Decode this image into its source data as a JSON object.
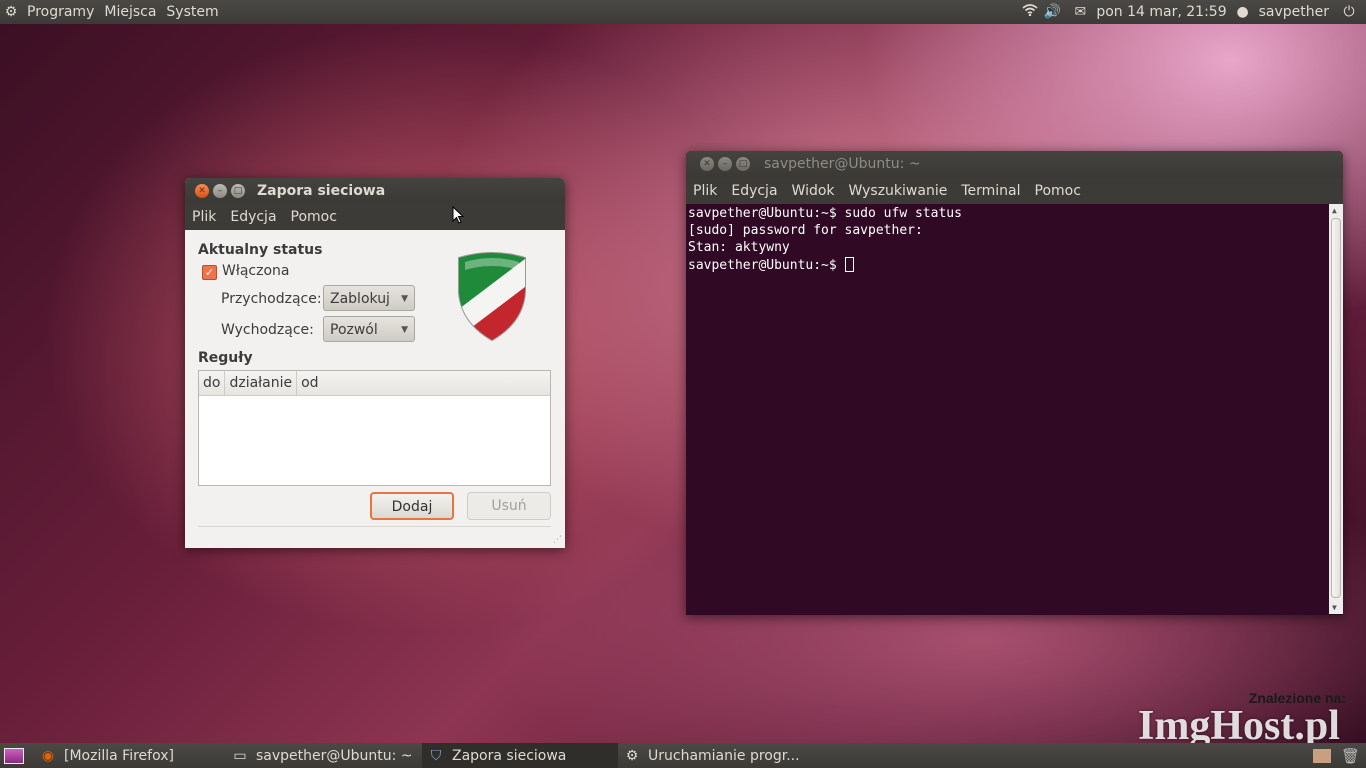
{
  "top_panel": {
    "menus": [
      "Programy",
      "Miejsca",
      "System"
    ],
    "datetime": "pon 14 mar, 21:59",
    "user": "savpether"
  },
  "firewall": {
    "title": "Zapora sieciowa",
    "menu": [
      "Plik",
      "Edycja",
      "Pomoc"
    ],
    "status_heading": "Aktualny status",
    "enabled_label": "Włączona",
    "incoming_label": "Przychodzące:",
    "incoming_value": "Zablokuj",
    "outgoing_label": "Wychodzące:",
    "outgoing_value": "Pozwól",
    "rules_heading": "Reguły",
    "rules_columns": [
      "do",
      "działanie",
      "od"
    ],
    "add_button": "Dodaj",
    "remove_button": "Usuń"
  },
  "terminal": {
    "title": "savpether@Ubuntu: ~",
    "menu": [
      "Plik",
      "Edycja",
      "Widok",
      "Wyszukiwanie",
      "Terminal",
      "Pomoc"
    ],
    "lines": [
      "savpether@Ubuntu:~$ sudo ufw status",
      "[sudo] password for savpether:",
      "Stan: aktywny",
      "savpether@Ubuntu:~$ "
    ]
  },
  "taskbar": {
    "tasks": [
      "[Mozilla Firefox]",
      "savpether@Ubuntu: ~",
      "Zapora sieciowa",
      "Uruchamianie progr..."
    ]
  },
  "watermark": {
    "line1": "Znalezione na:",
    "line2": "ImgHost.pl"
  },
  "colors": {
    "accent": "#e9743e",
    "terminal_bg": "#300a24",
    "panel": "#3c3b37"
  }
}
